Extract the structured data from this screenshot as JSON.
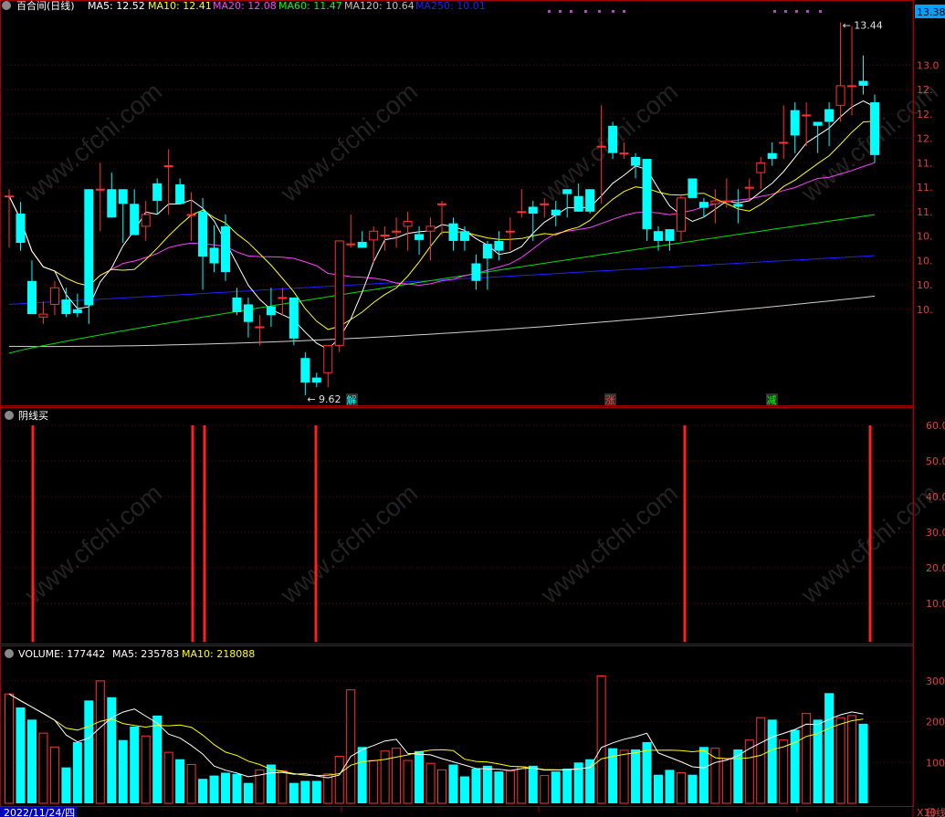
{
  "main_panel": {
    "stock_name": "百合间(日线)",
    "ma_legend": [
      {
        "text": "MA5: 12.52",
        "color": "#ffffff"
      },
      {
        "text": "MA10: 12.41",
        "color": "#ffff00"
      },
      {
        "text": "MA20: 12.08",
        "color": "#ff40ff"
      },
      {
        "text": "MA60: 11.47",
        "color": "#00ff00"
      },
      {
        "text": "MA120: 10.64",
        "color": "#c0c0c0"
      },
      {
        "text": "MA250: 10.01",
        "color": "#2020ff"
      }
    ],
    "price_tag": "13.38",
    "y_ticks": [
      "13.0",
      "12.",
      "12.",
      "12.",
      "11.",
      "11.",
      "11.",
      "10.",
      "10.",
      "10.",
      "10."
    ],
    "high_label": "13.44",
    "low_label": "9.62",
    "markers": [
      {
        "text": "解",
        "color": "#00ffff"
      },
      {
        "text": "涨",
        "color": "#ff4040"
      },
      {
        "text": "减",
        "color": "#00ff00"
      }
    ]
  },
  "signal_panel": {
    "title": "阴线买",
    "y_ticks": [
      "60.0",
      "50.0",
      "40.0",
      "30.0",
      "20.0",
      "10.0"
    ]
  },
  "volume_panel": {
    "legend": [
      {
        "text": "VOLUME: 177442",
        "color": "#ffffff"
      },
      {
        "text": "MA5: 235783",
        "color": "#ffffff"
      },
      {
        "text": "MA10: 218088",
        "color": "#ffff00"
      }
    ],
    "y_ticks": [
      "300",
      "200",
      "100"
    ],
    "y_unit": "X10"
  },
  "bottom_axis": {
    "date": "2022/11/24/四",
    "right_label": "日线"
  },
  "watermark": "www.cfchi.com",
  "chart_data": {
    "type": "candlestick",
    "price_ylim": [
      9.6,
      13.5
    ],
    "candles": [
      {
        "o": 11.66,
        "h": 11.73,
        "l": 11.13,
        "c": 11.66
      },
      {
        "o": 11.48,
        "h": 11.6,
        "l": 11.1,
        "c": 11.18
      },
      {
        "o": 10.79,
        "h": 11.0,
        "l": 10.58,
        "c": 10.45
      },
      {
        "o": 10.42,
        "h": 10.58,
        "l": 10.35,
        "c": 10.45
      },
      {
        "o": 10.55,
        "h": 10.79,
        "l": 10.44,
        "c": 10.72
      },
      {
        "o": 10.6,
        "h": 10.72,
        "l": 10.42,
        "c": 10.45
      },
      {
        "o": 10.5,
        "h": 10.66,
        "l": 10.42,
        "c": 10.46
      },
      {
        "o": 11.73,
        "h": 11.73,
        "l": 10.35,
        "c": 10.54
      },
      {
        "o": 11.73,
        "h": 12.0,
        "l": 11.3,
        "c": 11.73
      },
      {
        "o": 11.73,
        "h": 11.9,
        "l": 11.44,
        "c": 11.44
      },
      {
        "o": 11.73,
        "h": 11.73,
        "l": 11.18,
        "c": 11.58
      },
      {
        "o": 11.58,
        "h": 11.73,
        "l": 11.26,
        "c": 11.26
      },
      {
        "o": 11.35,
        "h": 11.61,
        "l": 11.2,
        "c": 11.47
      },
      {
        "o": 11.79,
        "h": 11.84,
        "l": 11.47,
        "c": 11.61
      },
      {
        "o": 11.97,
        "h": 12.14,
        "l": 11.47,
        "c": 11.97
      },
      {
        "o": 11.78,
        "h": 11.84,
        "l": 11.66,
        "c": 11.58
      },
      {
        "o": 11.47,
        "h": 11.7,
        "l": 11.2,
        "c": 11.47
      },
      {
        "o": 11.5,
        "h": 11.64,
        "l": 10.7,
        "c": 11.04
      },
      {
        "o": 11.13,
        "h": 11.36,
        "l": 10.88,
        "c": 10.97
      },
      {
        "o": 11.35,
        "h": 11.47,
        "l": 10.79,
        "c": 10.88
      },
      {
        "o": 10.62,
        "h": 10.72,
        "l": 10.44,
        "c": 10.47
      },
      {
        "o": 10.55,
        "h": 10.62,
        "l": 10.21,
        "c": 10.37
      },
      {
        "o": 10.32,
        "h": 10.44,
        "l": 10.13,
        "c": 10.32
      },
      {
        "o": 10.53,
        "h": 10.72,
        "l": 10.32,
        "c": 10.44
      },
      {
        "o": 10.62,
        "h": 10.72,
        "l": 10.44,
        "c": 10.62
      },
      {
        "o": 10.62,
        "h": 10.62,
        "l": 10.13,
        "c": 10.2
      },
      {
        "o": 10.0,
        "h": 10.06,
        "l": 9.62,
        "c": 9.75
      },
      {
        "o": 9.8,
        "h": 9.85,
        "l": 9.7,
        "c": 9.75
      },
      {
        "o": 9.85,
        "h": 10.13,
        "l": 9.7,
        "c": 10.13
      },
      {
        "o": 10.13,
        "h": 11.17,
        "l": 10.06,
        "c": 11.2
      },
      {
        "o": 11.17,
        "h": 11.47,
        "l": 11.13,
        "c": 11.17
      },
      {
        "o": 11.19,
        "h": 11.3,
        "l": 11.13,
        "c": 11.13
      },
      {
        "o": 11.21,
        "h": 11.35,
        "l": 10.98,
        "c": 11.3
      },
      {
        "o": 11.26,
        "h": 11.35,
        "l": 11.1,
        "c": 11.26
      },
      {
        "o": 11.3,
        "h": 11.44,
        "l": 11.13,
        "c": 11.3
      },
      {
        "o": 11.35,
        "h": 11.5,
        "l": 11.1,
        "c": 11.4
      },
      {
        "o": 11.27,
        "h": 11.35,
        "l": 11.06,
        "c": 11.21
      },
      {
        "o": 11.3,
        "h": 11.44,
        "l": 11.0,
        "c": 11.35
      },
      {
        "o": 11.58,
        "h": 11.61,
        "l": 11.26,
        "c": 11.58
      },
      {
        "o": 11.38,
        "h": 11.44,
        "l": 11.1,
        "c": 11.2
      },
      {
        "o": 11.3,
        "h": 11.35,
        "l": 11.1,
        "c": 11.2
      },
      {
        "o": 10.97,
        "h": 11.06,
        "l": 10.7,
        "c": 10.79
      },
      {
        "o": 11.17,
        "h": 11.2,
        "l": 10.7,
        "c": 11.02
      },
      {
        "o": 11.2,
        "h": 11.3,
        "l": 11.0,
        "c": 11.1
      },
      {
        "o": 11.3,
        "h": 11.44,
        "l": 11.1,
        "c": 11.3
      },
      {
        "o": 11.5,
        "h": 11.73,
        "l": 11.44,
        "c": 11.5
      },
      {
        "o": 11.55,
        "h": 11.61,
        "l": 11.2,
        "c": 11.48
      },
      {
        "o": 11.58,
        "h": 11.64,
        "l": 11.44,
        "c": 11.58
      },
      {
        "o": 11.52,
        "h": 11.61,
        "l": 11.35,
        "c": 11.46
      },
      {
        "o": 11.73,
        "h": 11.73,
        "l": 11.44,
        "c": 11.68
      },
      {
        "o": 11.66,
        "h": 11.79,
        "l": 11.5,
        "c": 11.5
      },
      {
        "o": 11.73,
        "h": 11.73,
        "l": 11.48,
        "c": 11.5
      },
      {
        "o": 12.17,
        "h": 12.59,
        "l": 11.58,
        "c": 12.17
      },
      {
        "o": 12.38,
        "h": 12.42,
        "l": 12.04,
        "c": 12.1
      },
      {
        "o": 12.1,
        "h": 12.21,
        "l": 12.04,
        "c": 12.1
      },
      {
        "o": 12.06,
        "h": 12.1,
        "l": 11.84,
        "c": 11.97
      },
      {
        "o": 12.04,
        "h": 12.04,
        "l": 11.2,
        "c": 11.32
      },
      {
        "o": 11.3,
        "h": 11.35,
        "l": 11.1,
        "c": 11.2
      },
      {
        "o": 11.32,
        "h": 11.32,
        "l": 11.1,
        "c": 11.2
      },
      {
        "o": 11.3,
        "h": 11.66,
        "l": 11.2,
        "c": 11.64
      },
      {
        "o": 11.84,
        "h": 11.84,
        "l": 11.64,
        "c": 11.64
      },
      {
        "o": 11.6,
        "h": 11.64,
        "l": 11.44,
        "c": 11.54
      },
      {
        "o": 11.58,
        "h": 11.73,
        "l": 11.38,
        "c": 11.61
      },
      {
        "o": 11.61,
        "h": 11.84,
        "l": 11.54,
        "c": 11.61
      },
      {
        "o": 11.58,
        "h": 11.73,
        "l": 11.38,
        "c": 11.55
      },
      {
        "o": 11.74,
        "h": 11.84,
        "l": 11.6,
        "c": 11.75
      },
      {
        "o": 11.9,
        "h": 12.06,
        "l": 11.73,
        "c": 12.0
      },
      {
        "o": 12.1,
        "h": 12.21,
        "l": 11.97,
        "c": 12.04
      },
      {
        "o": 12.21,
        "h": 12.59,
        "l": 12.04,
        "c": 12.21
      },
      {
        "o": 12.54,
        "h": 12.62,
        "l": 12.1,
        "c": 12.28
      },
      {
        "o": 12.49,
        "h": 12.62,
        "l": 12.17,
        "c": 12.49
      },
      {
        "o": 12.42,
        "h": 12.42,
        "l": 12.1,
        "c": 12.38
      },
      {
        "o": 12.55,
        "h": 12.62,
        "l": 12.17,
        "c": 12.42
      },
      {
        "o": 12.59,
        "h": 13.44,
        "l": 12.42,
        "c": 12.79
      },
      {
        "o": 12.79,
        "h": 13.4,
        "l": 12.49,
        "c": 12.79
      },
      {
        "o": 12.84,
        "h": 13.1,
        "l": 12.7,
        "c": 12.79
      },
      {
        "o": 12.62,
        "h": 12.7,
        "l": 12.0,
        "c": 12.08
      }
    ],
    "volume": [
      268,
      235,
      205,
      172,
      138,
      88,
      150,
      252,
      300,
      260,
      155,
      188,
      165,
      215,
      125,
      108,
      95,
      60,
      68,
      75,
      72,
      50,
      82,
      95,
      80,
      50,
      55,
      55,
      72,
      115,
      278,
      138,
      105,
      128,
      135,
      105,
      128,
      98,
      82,
      95,
      66,
      85,
      92,
      78,
      80,
      90,
      92,
      68,
      78,
      85,
      100,
      108,
      312,
      135,
      130,
      132,
      150,
      70,
      82,
      75,
      70,
      138,
      135,
      110,
      132,
      155,
      210,
      205,
      155,
      180,
      220,
      205,
      270,
      210,
      215,
      195
    ]
  }
}
